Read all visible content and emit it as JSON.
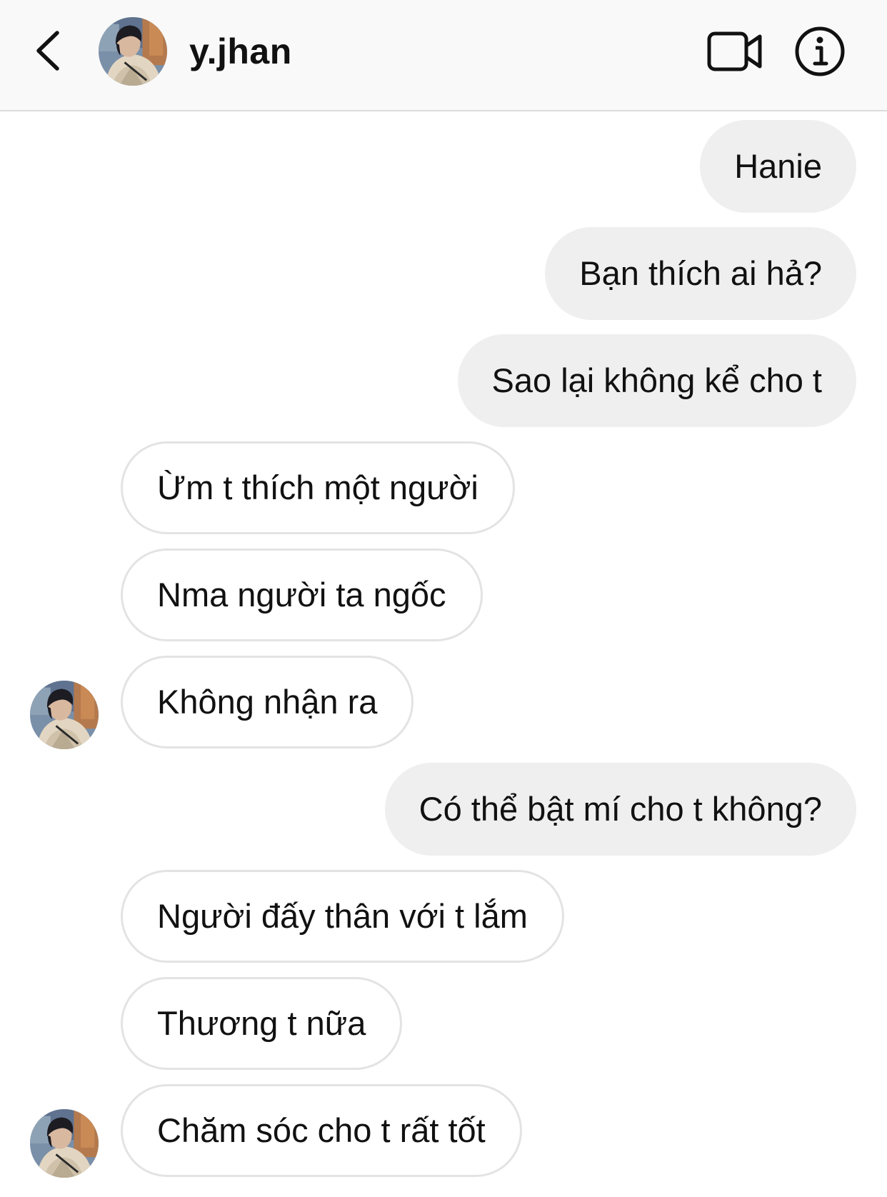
{
  "header": {
    "username": "y.jhan"
  },
  "icons": {
    "back": "chevron-left-icon",
    "video": "video-camera-icon",
    "info": "info-icon"
  },
  "messages": [
    {
      "side": "out",
      "text": "Hanie"
    },
    {
      "side": "out",
      "text": "Bạn thích ai hả?"
    },
    {
      "side": "out",
      "text": "Sao lại không kể cho t"
    },
    {
      "side": "in",
      "text": "Ừm t thích một người"
    },
    {
      "side": "in",
      "text": "Nma người ta ngốc"
    },
    {
      "side": "in",
      "text": "Không nhận ra"
    },
    {
      "side": "out",
      "text": "Có thể bật mí cho t không?"
    },
    {
      "side": "in",
      "text": "Người đấy thân với t lắm"
    },
    {
      "side": "in",
      "text": "Thương t nữa"
    },
    {
      "side": "in",
      "text": "Chăm sóc cho t rất tốt"
    }
  ]
}
